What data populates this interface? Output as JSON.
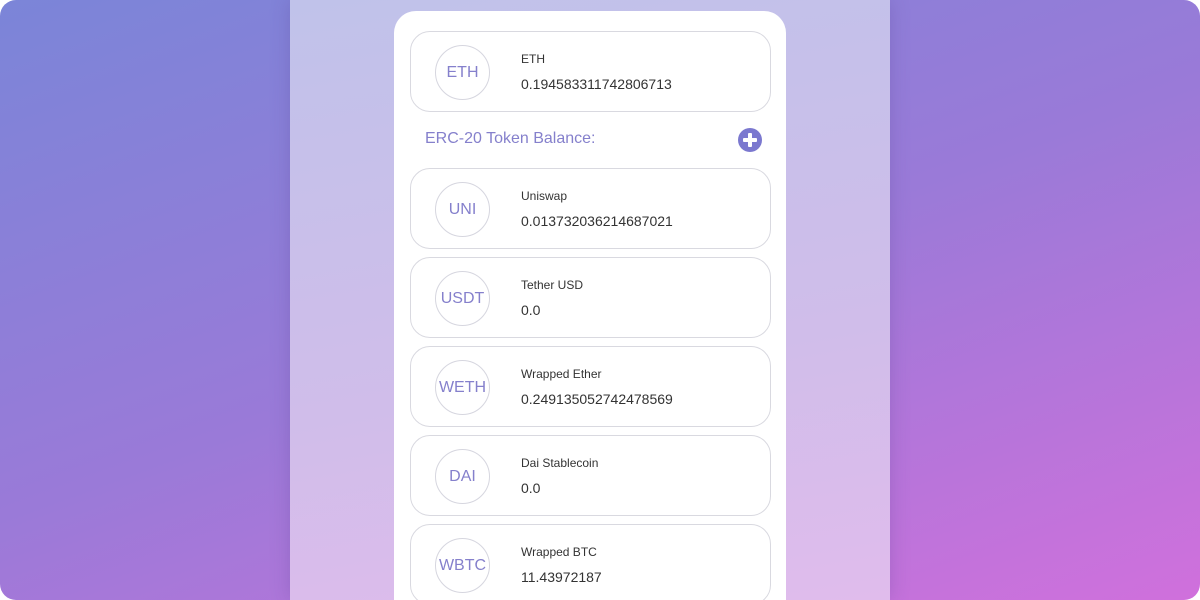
{
  "eth": {
    "symbol": "ETH",
    "name": "ETH",
    "balance": "0.194583311742806713"
  },
  "erc20": {
    "title": "ERC-20 Token Balance:",
    "tokens": [
      {
        "symbol": "UNI",
        "name": "Uniswap",
        "balance": "0.013732036214687021"
      },
      {
        "symbol": "USDT",
        "name": "Tether USD",
        "balance": "0.0"
      },
      {
        "symbol": "WETH",
        "name": "Wrapped Ether",
        "balance": "0.249135052742478569"
      },
      {
        "symbol": "DAI",
        "name": "Dai Stablecoin",
        "balance": "0.0"
      },
      {
        "symbol": "WBTC",
        "name": "Wrapped BTC",
        "balance": "11.43972187"
      }
    ]
  },
  "colors": {
    "accent": "#8580cc",
    "button": "#7b78cf"
  },
  "icons": {
    "add": "plus-circle-icon"
  }
}
